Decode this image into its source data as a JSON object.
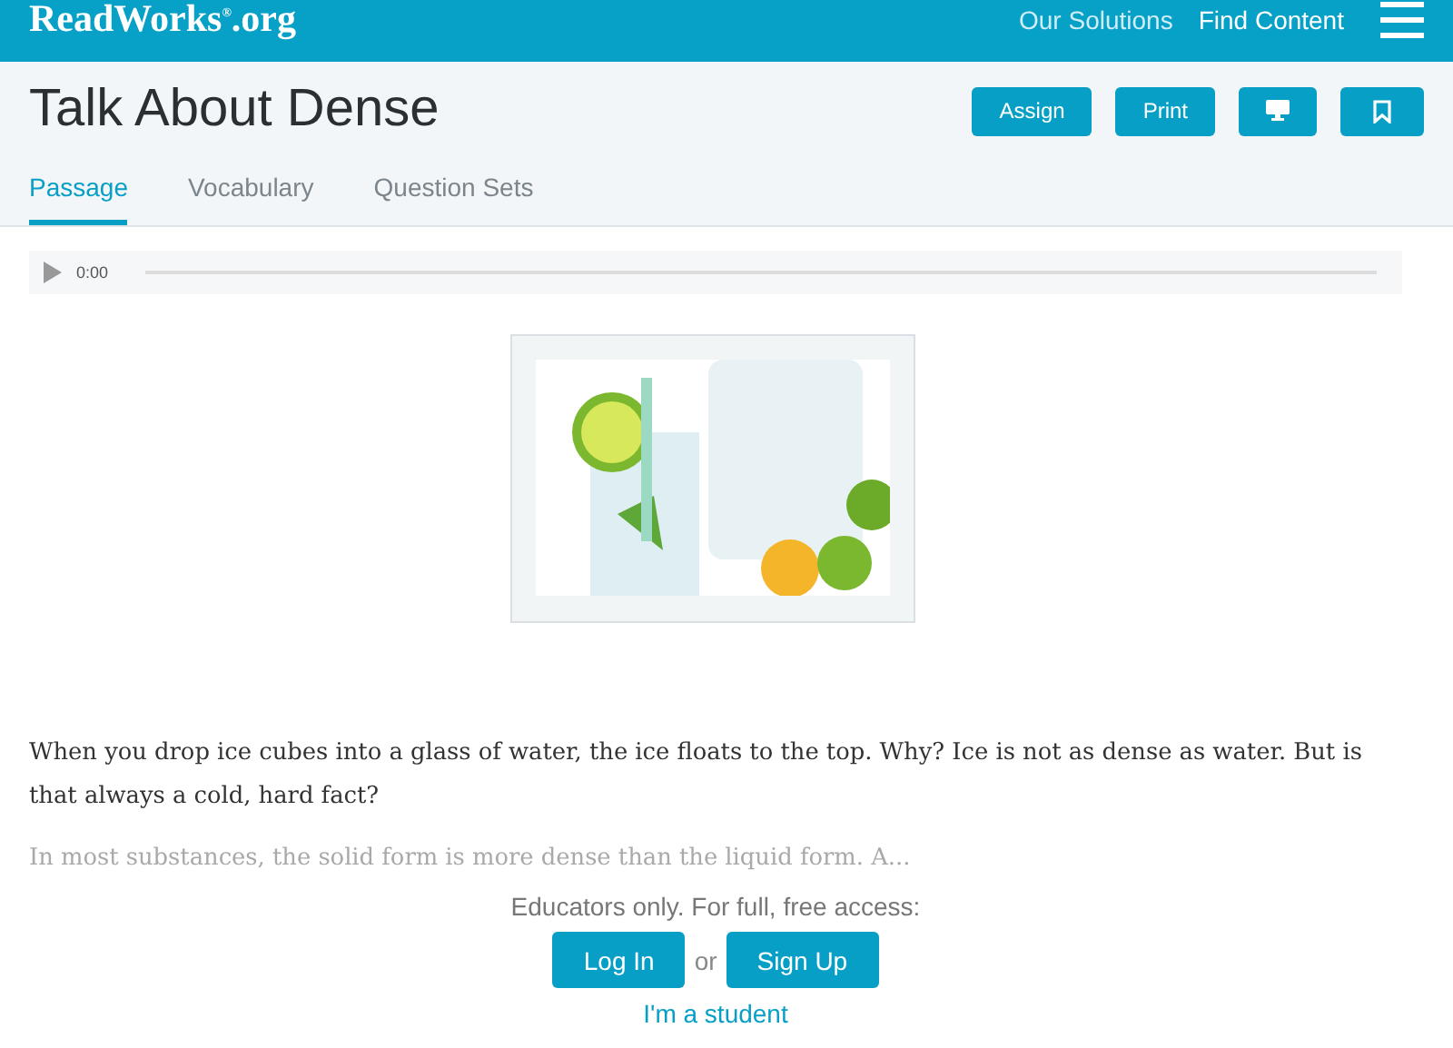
{
  "header": {
    "logo": "ReadWorks$^{®}$.org",
    "nav": [
      "Our Solutions",
      "Find Content"
    ]
  },
  "title": "Talk About Dense",
  "actions": [
    {
      "kind": "text",
      "label": "Assign"
    },
    {
      "kind": "text",
      "label": "Print"
    },
    {
      "kind": "monitor"
    },
    {
      "kind": "bookmark"
    }
  ],
  "tabs": [
    {
      "label": "Passage",
      "selected": true
    },
    {
      "label": "Vocabulary",
      "selected": false
    },
    {
      "label": "Question Sets",
      "selected": false
    }
  ],
  "audio": {
    "time": "0:00"
  },
  "passage": [
    {
      "text": "When you drop ice cubes into a glass of water, the ice floats to the top. Why? Ice is not as dense as water. But is that always a cold, hard fact?",
      "faded": false
    },
    {
      "text": "In most substances, the solid form is more dense than the liquid form. A...",
      "faded": true
    }
  ],
  "access": {
    "prompt": "Educators only. For full, free access:",
    "login": "Log In",
    "or": "or",
    "signup": "Sign Up",
    "student": "I'm a student"
  }
}
